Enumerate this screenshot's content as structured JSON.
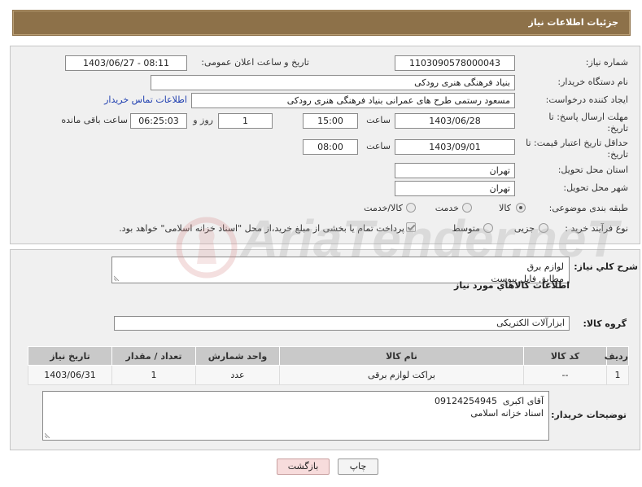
{
  "header": {
    "title": "جزئیات اطلاعات نیاز"
  },
  "need_info": {
    "need_number": {
      "label": "شماره نیاز:",
      "value": "1103090578000043"
    },
    "announce_datetime": {
      "label": "تاریخ و ساعت اعلان عمومی:",
      "value": "1403/06/27 - 08:11"
    },
    "buyer_org": {
      "label": "نام دستگاه خریدار:",
      "value": "بنیاد فرهنگی هنری رودکی"
    },
    "requester": {
      "label": "ایجاد کننده درخواست:",
      "value": "مسعود رستمی طرح های عمرانی بنیاد فرهنگی هنری رودکی",
      "contact_link": "اطلاعات تماس خریدار"
    },
    "response_deadline": {
      "label_line1": "مهلت ارسال پاسخ: تا",
      "label_line2": "تاریخ:",
      "date": "1403/06/28",
      "time_label": "ساعت",
      "time": "15:00",
      "days": "1",
      "days_label": "روز و",
      "remaining_time": "06:25:03",
      "remaining_label": "ساعت باقی مانده"
    },
    "price_validity": {
      "label_line1": "حداقل تاریخ اعتبار قیمت: تا",
      "label_line2": "تاریخ:",
      "date": "1403/09/01",
      "time_label": "ساعت",
      "time": "08:00"
    },
    "delivery_province": {
      "label": "استان محل تحویل:",
      "value": "تهران"
    },
    "delivery_city": {
      "label": "شهر محل تحویل:",
      "value": "تهران"
    },
    "subject_category": {
      "label": "طبقه بندی موضوعی:",
      "options": [
        {
          "label": "کالا",
          "selected": true
        },
        {
          "label": "خدمت",
          "selected": false
        },
        {
          "label": "کالا/خدمت",
          "selected": false
        }
      ]
    },
    "purchase_process": {
      "label": "نوع فرآیند خرید :",
      "options": [
        {
          "label": "جزیی",
          "selected": false
        },
        {
          "label": "متوسط",
          "selected": false
        }
      ],
      "treasury_payment": {
        "checked": true,
        "label": "پرداخت تمام یا بخشی از مبلغ خرید،از محل \"اسناد خزانه اسلامی\" خواهد بود."
      }
    }
  },
  "need_details": {
    "description": {
      "label": "شرح کلي نياز:",
      "lines": [
        "لوازم برق",
        "مطابق فایل پیوست"
      ]
    },
    "goods_heading": "اطلاعات کالاهاي مورد نياز",
    "goods_group": {
      "label": "گروه کالا:",
      "value": "ابزارآلات الکتریکی"
    },
    "goods_table": {
      "columns": [
        "ردیف",
        "کد کالا",
        "نام کالا",
        "واحد شمارش",
        "تعداد / مقدار",
        "تاریخ نیاز"
      ],
      "rows": [
        [
          "1",
          "--",
          "براکت لوازم برقی",
          "عدد",
          "1",
          "1403/06/31"
        ]
      ]
    },
    "buyer_notes": {
      "label": "توضیحات خریدار:",
      "lines": [
        "آقای اکبری  09124254945",
        "اسناد خزانه اسلامی"
      ]
    }
  },
  "actions": {
    "print": "چاپ",
    "back": "بازگشت"
  },
  "watermark": "AriaTender.neT",
  "colors": {
    "header_bar": "#8d7149",
    "panel_bg": "#f0f0f0",
    "link": "#1f3fb0",
    "table_header": "#c9c9c9",
    "back_button": "#f7dcdc"
  }
}
